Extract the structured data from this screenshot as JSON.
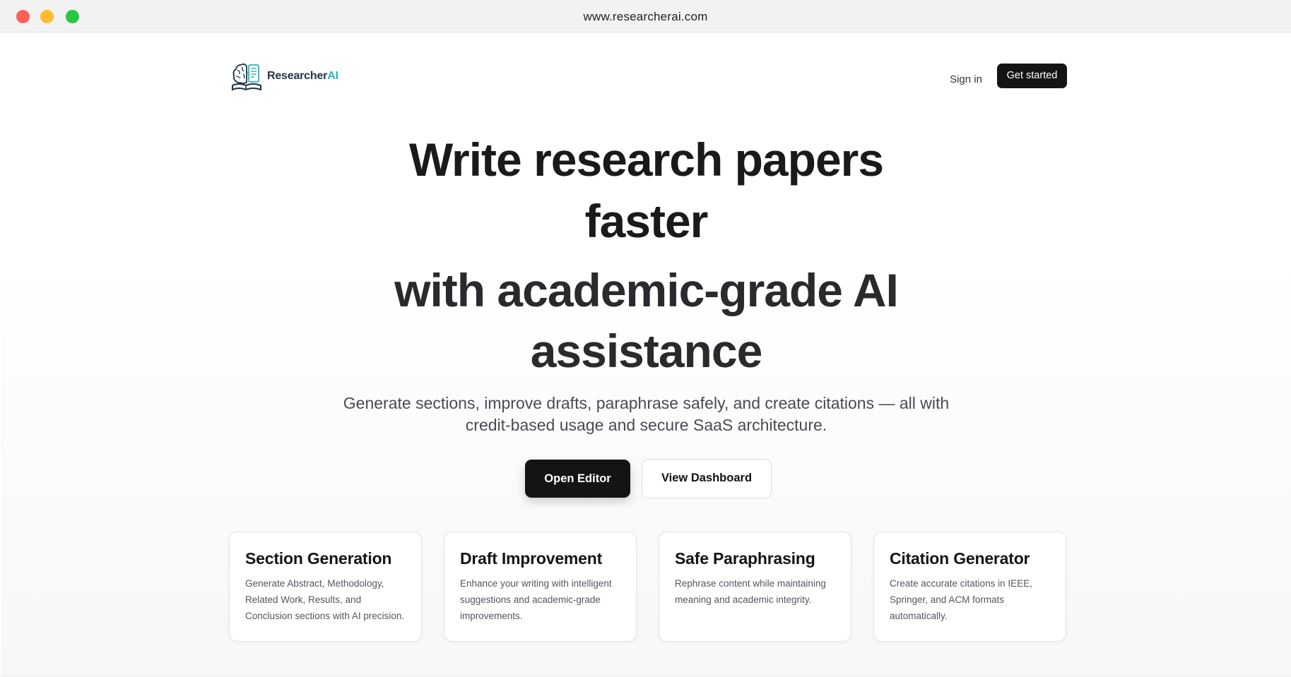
{
  "browser": {
    "url": "www.researcherai.com"
  },
  "header": {
    "logo_text_main": "Researcher",
    "logo_text_accent": "AI",
    "signin_label": "Sign in",
    "getstarted_label": "Get started"
  },
  "hero": {
    "line1": "Write research papers",
    "line2": "faster",
    "line3": "with academic-grade AI",
    "line4": "assistance",
    "subtitle_line1": "Generate sections, improve drafts, paraphrase safely, and create citations — all with",
    "subtitle_line2": "credit-based usage and secure SaaS architecture.",
    "primary_button": "Open Editor",
    "secondary_button": "View Dashboard"
  },
  "features": [
    {
      "title": "Section Generation",
      "desc_lines": [
        "Generate Abstract, Methodology,",
        "Related Work, Results, and",
        "Conclusion sections with AI precision."
      ]
    },
    {
      "title": "Draft Improvement",
      "desc_lines": [
        "Enhance your writing with intelligent",
        "suggestions and academic-grade",
        "improvements."
      ]
    },
    {
      "title": "Safe Paraphrasing",
      "desc_lines": [
        "Rephrase content while maintaining",
        "meaning and academic integrity."
      ]
    },
    {
      "title": "Citation Generator",
      "desc_lines": [
        "Create accurate citations in IEEE,",
        "Springer, and ACM formats",
        "automatically."
      ]
    }
  ],
  "colors": {
    "dark_button": "#141416",
    "logo_navy": "#1f3446",
    "logo_teal": "#2bb3b8"
  },
  "icons": {
    "logo": "brain-book-icon"
  }
}
